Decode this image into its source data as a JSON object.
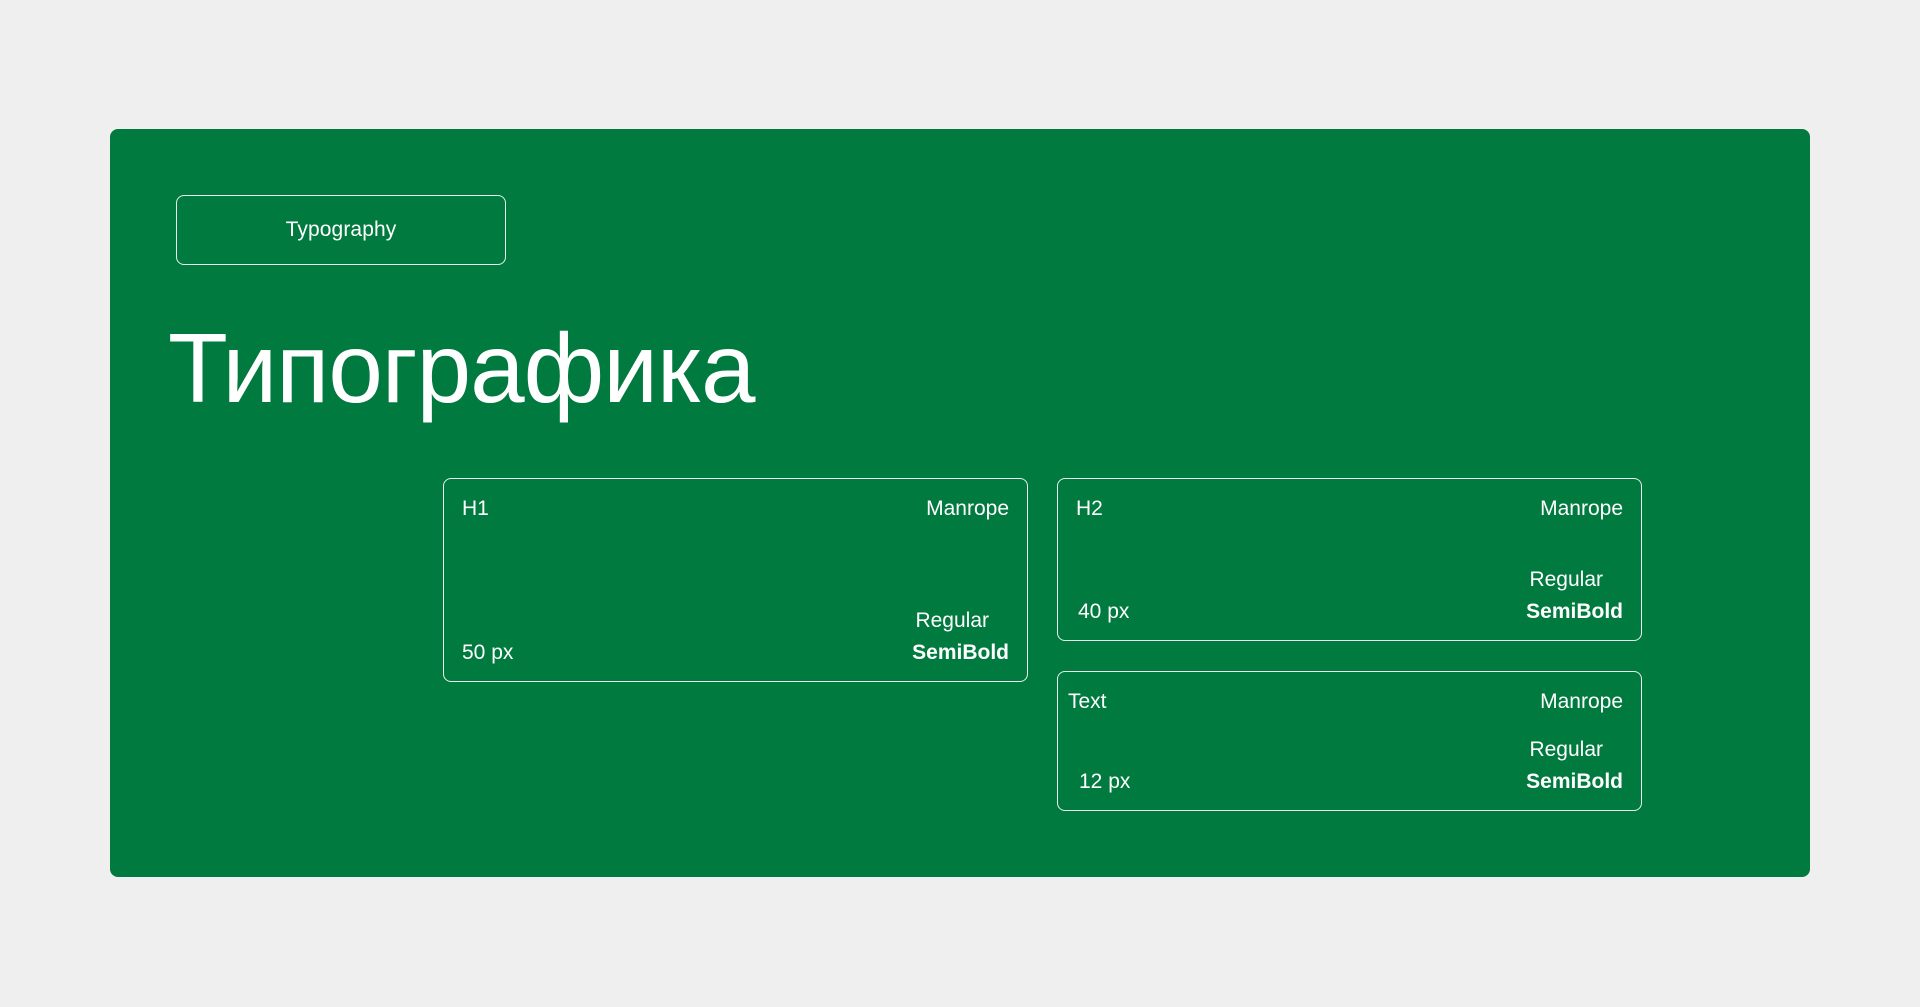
{
  "tag": {
    "label": "Typography"
  },
  "title": "Типографика",
  "cards": {
    "h1": {
      "name": "H1",
      "font": "Manrope",
      "size": "50 px",
      "weight_regular": "Regular",
      "weight_semibold": "SemiBold"
    },
    "h2": {
      "name": "H2",
      "font": "Manrope",
      "size": "40 px",
      "weight_regular": "Regular",
      "weight_semibold": "SemiBold"
    },
    "text": {
      "name": "Text",
      "font": "Manrope",
      "size": "12 px",
      "weight_regular": "Regular",
      "weight_semibold": "SemiBold"
    }
  },
  "colors": {
    "background": "#efefef",
    "panel": "#017a3f",
    "foreground": "#ffffff"
  }
}
